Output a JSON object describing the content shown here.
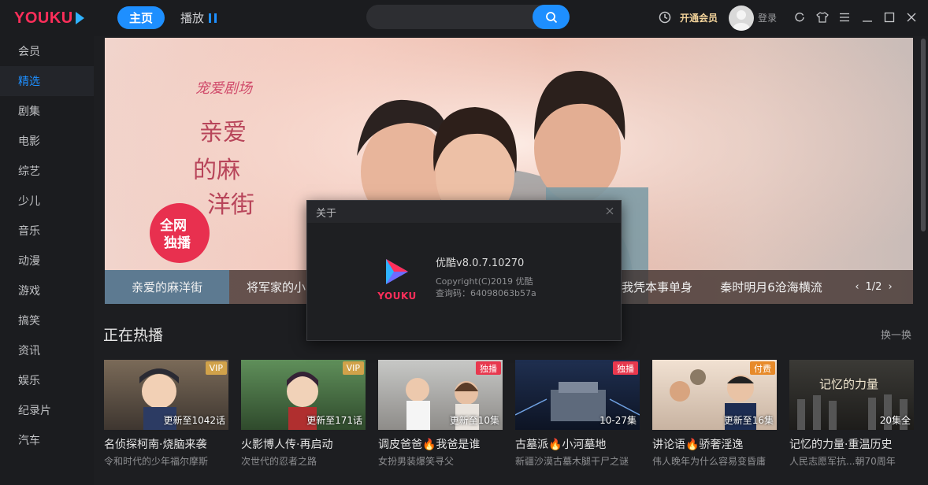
{
  "app": {
    "brand": "YOUKU",
    "accent": "#1e8fff",
    "brand_color": "#ff2e5a"
  },
  "topbar": {
    "home_label": "主页",
    "play_label": "播放",
    "search_placeholder": "",
    "vip_label": "开通会员",
    "login_label": "登录",
    "icons": [
      "history-icon",
      "avatar",
      "refresh-icon",
      "skin-icon",
      "menu-icon",
      "minimize-icon",
      "maximize-icon",
      "close-icon"
    ]
  },
  "sidebar": {
    "items": [
      {
        "label": "会员"
      },
      {
        "label": "精选",
        "active": true
      },
      {
        "label": "剧集"
      },
      {
        "label": "电影"
      },
      {
        "label": "综艺"
      },
      {
        "label": "少儿"
      },
      {
        "label": "音乐"
      },
      {
        "label": "动漫"
      },
      {
        "label": "游戏"
      },
      {
        "label": "搞笑"
      },
      {
        "label": "资讯"
      },
      {
        "label": "娱乐"
      },
      {
        "label": "纪录片"
      },
      {
        "label": "汽车"
      }
    ]
  },
  "banner": {
    "show_logo": "宠爱剧场",
    "show_title": "亲爱的麻洋街",
    "corner_badge": "全网独播",
    "tabs": [
      "亲爱的麻洋街",
      "将军家的小",
      "我凭本事单身",
      "秦时明月6沧海横流"
    ],
    "pager": "1/2"
  },
  "section": {
    "title": "正在热播",
    "refresh_label": "换一换"
  },
  "cards": [
    {
      "badge": "VIP",
      "badge_type": "vip",
      "ep": "更新至1042话",
      "title": "名侦探柯南·烧脑来袭",
      "sub": "令和时代的少年福尔摩斯"
    },
    {
      "badge": "VIP",
      "badge_type": "vip",
      "ep": "更新至171话",
      "title": "火影博人传·再启动",
      "sub": "次世代的忍者之路"
    },
    {
      "badge": "独播",
      "badge_type": "dubo",
      "ep": "更新至10集",
      "title": "调皮爸爸🔥我爸是谁",
      "sub": "女扮男装爆笑寻父"
    },
    {
      "badge": "独播",
      "badge_type": "dubo",
      "ep": "10-27集",
      "title": "古墓派🔥小河墓地",
      "sub": "新疆沙漠古墓木腿干尸之谜"
    },
    {
      "badge": "付费",
      "badge_type": "pay",
      "ep": "更新至16集",
      "title": "讲论语🔥骄奢淫逸",
      "sub": "伟人晚年为什么容易变昏庸"
    },
    {
      "badge": "",
      "badge_type": "",
      "ep": "20集全",
      "title": "记忆的力量·重温历史",
      "sub": "人民志愿军抗...朝70周年",
      "thumb_caption": "记忆的力量"
    }
  ],
  "dialog": {
    "title": "关于",
    "name": "优酷v8.0.7.10270",
    "copyright": "Copyright(C)2019 优酷",
    "query_code": "查询码：64098063b57a",
    "logo_text": "YOUKU"
  }
}
